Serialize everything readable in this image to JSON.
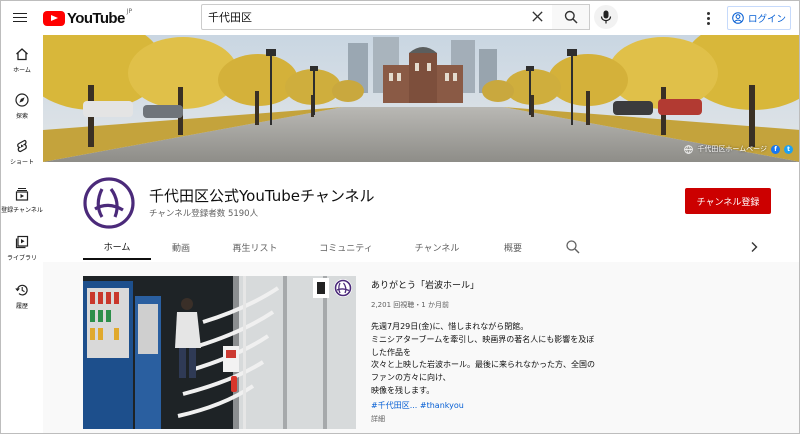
{
  "header": {
    "logo_text": "YouTube",
    "logo_region": "JP",
    "search_value": "千代田区",
    "login_label": "ログイン"
  },
  "sidebar": {
    "items": [
      {
        "label": "ホーム",
        "icon": "home-icon"
      },
      {
        "label": "探索",
        "icon": "compass-icon"
      },
      {
        "label": "ショート",
        "icon": "shorts-icon"
      },
      {
        "label": "登録チャンネル",
        "icon": "subscriptions-icon"
      },
      {
        "label": "ライブラリ",
        "icon": "library-icon"
      },
      {
        "label": "履歴",
        "icon": "history-icon"
      }
    ]
  },
  "banner": {
    "link_label": "千代田区ホームページ"
  },
  "channel": {
    "title": "千代田区公式YouTubeチャンネル",
    "subscribers": "チャンネル登録者数 5190人",
    "subscribe_label": "チャンネル登録"
  },
  "tabs": [
    "ホーム",
    "動画",
    "再生リスト",
    "コミュニティ",
    "チャンネル",
    "概要"
  ],
  "featured_video": {
    "title": "ありがとう「岩波ホール」",
    "meta": "2,201 回視聴・1 か月前",
    "description": [
      "先週7月29日(金)に、惜しまれながら閉館。",
      "ミニシアターブームを牽引し、映画界の著名人にも影響を及ぼ",
      "した作品を",
      "次々と上映した岩波ホール。最後に来られなかった方、全国の",
      "ファンの方々に向け、",
      "映像を残します。"
    ],
    "hashtags": [
      "#千代田区...",
      "#thankyou"
    ],
    "details_label": "詳細"
  },
  "colors": {
    "brand_red": "#ff0000",
    "subscribe_red": "#cc0000",
    "link_blue": "#065fd4",
    "channel_purple": "#4b2a7a"
  }
}
